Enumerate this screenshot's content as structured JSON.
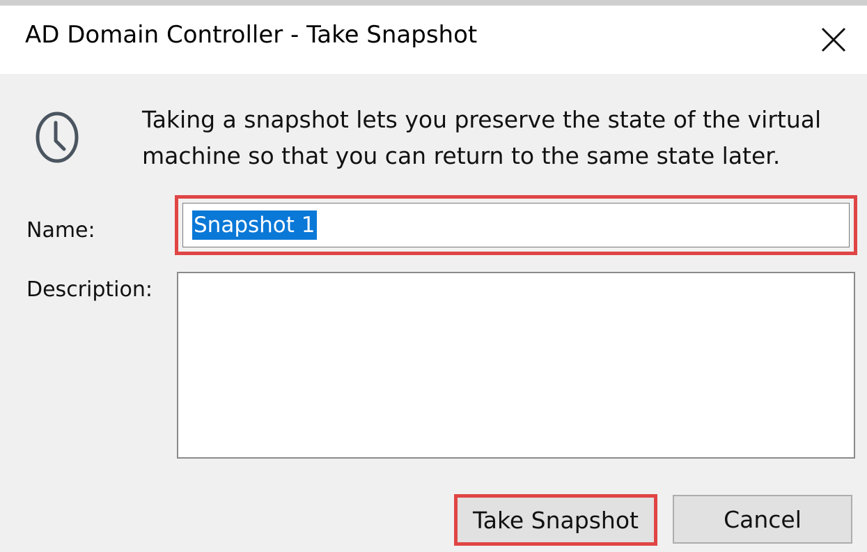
{
  "dialog": {
    "title": "AD Domain Controller - Take Snapshot",
    "close_icon": "close-icon",
    "info_icon": "clock-icon",
    "info_text": "Taking a snapshot lets you preserve the state of the virtual machine so that you can return to the same state later."
  },
  "form": {
    "name_label": "Name:",
    "name_value": "Snapshot 1",
    "description_label": "Description:",
    "description_value": ""
  },
  "buttons": {
    "take_snapshot": "Take Snapshot",
    "cancel": "Cancel"
  },
  "colors": {
    "highlight": "#e04545",
    "selection": "#0a78d7"
  }
}
